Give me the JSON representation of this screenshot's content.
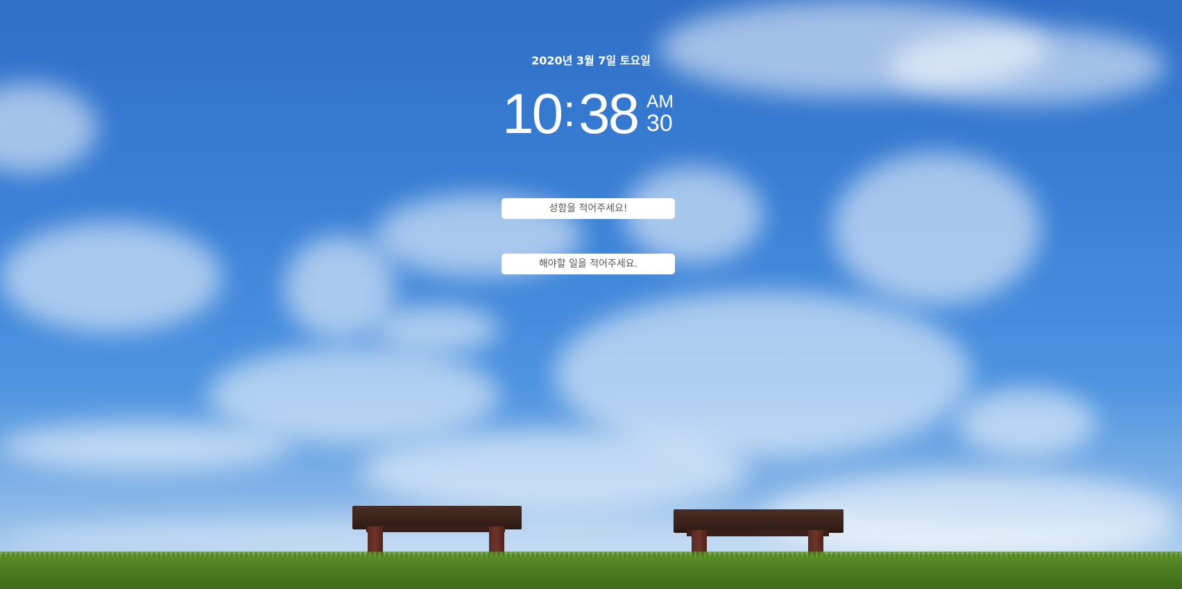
{
  "date_text": "2020년 3월 7일 토요일",
  "clock": {
    "hours": "10",
    "separator": ":",
    "minutes": "38",
    "meridiem": "AM",
    "seconds": "30"
  },
  "name_input": {
    "placeholder": "성함을 적어주세요!",
    "value": ""
  },
  "todo_input": {
    "placeholder": "해야할 일을 적어주세요.",
    "value": ""
  },
  "colors": {
    "text": "#ffffff",
    "input_background": "#ffffff",
    "sky": "#3a80d6",
    "grass": "#4f7f22",
    "bench": "#3a221b"
  }
}
